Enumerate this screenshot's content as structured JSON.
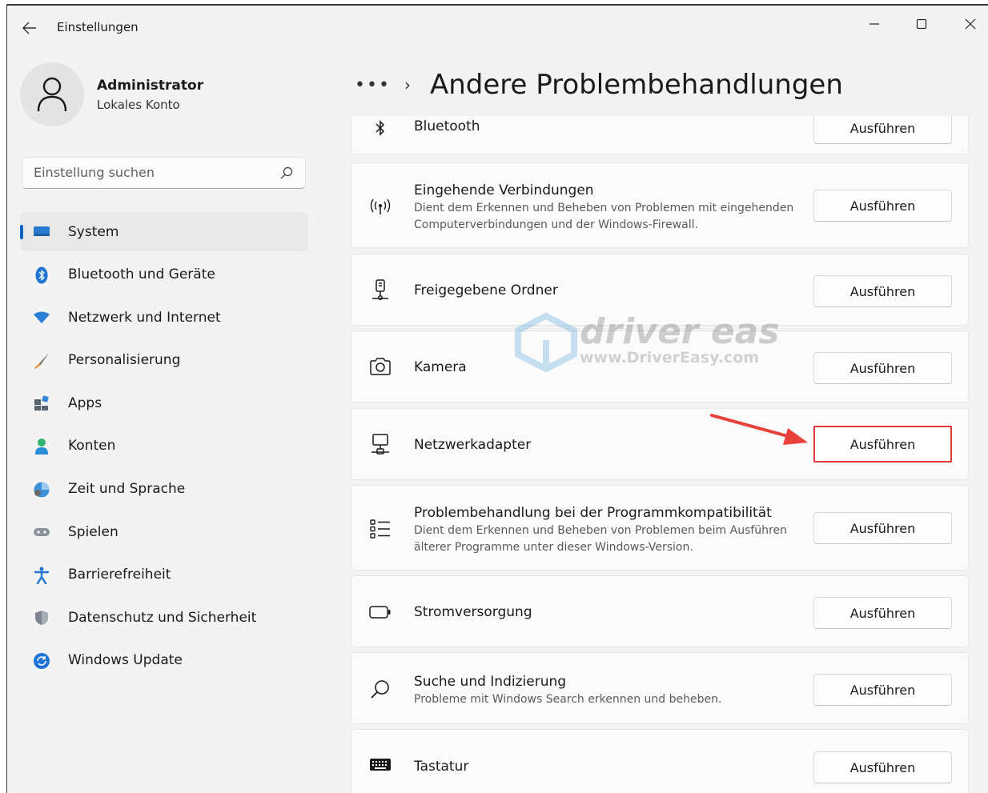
{
  "window": {
    "title": "Einstellungen",
    "controls": {
      "minimize": "–",
      "maximize": "☐",
      "close": "✕"
    }
  },
  "profile": {
    "name": "Administrator",
    "account_type": "Lokales Konto"
  },
  "search": {
    "placeholder": "Einstellung suchen",
    "value": ""
  },
  "sidebar": {
    "items": [
      {
        "label": "System",
        "icon": "system-icon",
        "selected": true
      },
      {
        "label": "Bluetooth und Geräte",
        "icon": "bluetooth-icon"
      },
      {
        "label": "Netzwerk und Internet",
        "icon": "wifi-icon"
      },
      {
        "label": "Personalisierung",
        "icon": "brush-icon"
      },
      {
        "label": "Apps",
        "icon": "apps-icon"
      },
      {
        "label": "Konten",
        "icon": "accounts-icon"
      },
      {
        "label": "Zeit und Sprache",
        "icon": "time-language-icon"
      },
      {
        "label": "Spielen",
        "icon": "gamepad-icon"
      },
      {
        "label": "Barrierefreiheit",
        "icon": "accessibility-icon"
      },
      {
        "label": "Datenschutz und Sicherheit",
        "icon": "shield-icon"
      },
      {
        "label": "Windows Update",
        "icon": "update-icon"
      }
    ]
  },
  "header": {
    "overflow": "•••",
    "separator": "›",
    "title": "Andere Problembehandlungen"
  },
  "troubleshooters": [
    {
      "title": "Bluetooth",
      "icon": "bluetooth-icon",
      "button": "Ausführen"
    },
    {
      "title": "Eingehende Verbindungen",
      "description": "Dient dem Erkennen und Beheben von Problemen mit eingehenden Computerverbindungen und der Windows-Firewall.",
      "icon": "antenna-icon",
      "button": "Ausführen"
    },
    {
      "title": "Freigegebene Ordner",
      "icon": "shared-folder-icon",
      "button": "Ausführen"
    },
    {
      "title": "Kamera",
      "icon": "camera-icon",
      "button": "Ausführen"
    },
    {
      "title": "Netzwerkadapter",
      "icon": "network-adapter-icon",
      "button": "Ausführen",
      "highlighted": true
    },
    {
      "title": "Problembehandlung bei der Programmkompatibilität",
      "description": "Dient dem Erkennen und Beheben von Problemen beim Ausführen älterer Programme unter dieser Windows-Version.",
      "icon": "list-icon",
      "button": "Ausführen"
    },
    {
      "title": "Stromversorgung",
      "icon": "battery-icon",
      "button": "Ausführen"
    },
    {
      "title": "Suche und Indizierung",
      "description": "Probleme mit Windows Search erkennen und beheben.",
      "icon": "search-icon",
      "button": "Ausführen"
    },
    {
      "title": "Tastatur",
      "icon": "keyboard-icon",
      "button": "Ausführen"
    }
  ],
  "watermark": {
    "brand": "driver easy",
    "url": "www.DriverEasy.com"
  },
  "colors": {
    "accent": "#0067c0",
    "highlight": "#e03a3a",
    "arrow": "#e8403a"
  }
}
